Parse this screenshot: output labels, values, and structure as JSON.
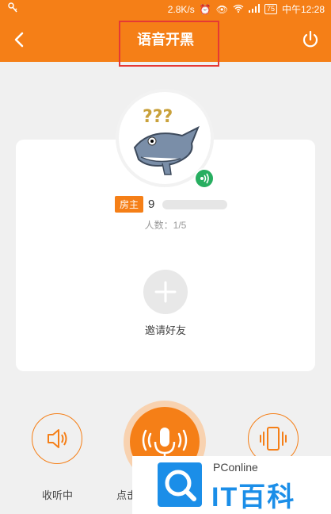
{
  "status_bar": {
    "speed": "2.8K/s",
    "battery": "75",
    "time": "中午12:28"
  },
  "header": {
    "title": "语音开黑"
  },
  "room": {
    "host_tag": "房主",
    "host_name_visible": "9",
    "member_count": "人数：1/5",
    "invite_label": "邀请好友"
  },
  "controls": {
    "listen_label": "收听中",
    "speak_label_partial": "点击"
  },
  "watermark": {
    "small": "PConline",
    "big": "IT百科"
  },
  "colors": {
    "accent": "#f57f17",
    "highlight_box": "#e53935",
    "speaking_badge": "#27ae60",
    "watermark_blue": "#1b8ee8"
  },
  "icons": [
    "key-icon",
    "alarm-icon",
    "eye-icon",
    "wifi-icon",
    "signal-icon",
    "battery-icon",
    "back-arrow-icon",
    "power-icon",
    "speaking-indicator-icon",
    "plus-icon",
    "speaker-icon",
    "microphone-icon",
    "vibrate-phone-icon",
    "pconline-logo-icon"
  ]
}
